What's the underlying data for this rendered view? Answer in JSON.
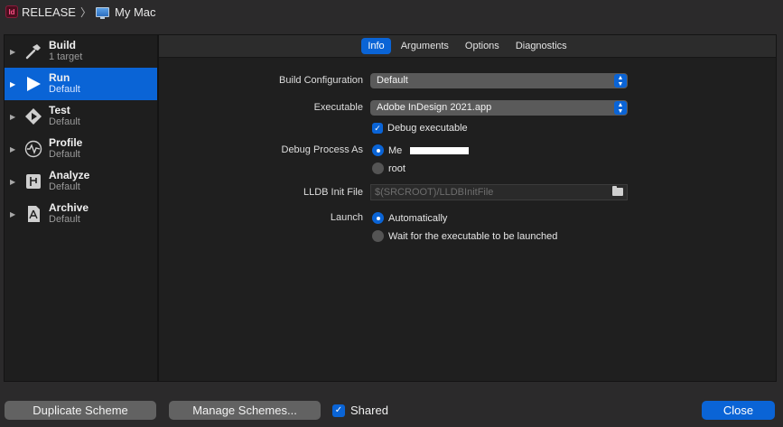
{
  "breadcrumb": {
    "app_badge": "Id",
    "scheme": "RELEASE",
    "separator": "〉",
    "destination": "My Mac"
  },
  "sidebar": {
    "items": [
      {
        "title": "Build",
        "subtitle": "1 target",
        "icon": "hammer-icon",
        "selected": false
      },
      {
        "title": "Run",
        "subtitle": "Default",
        "icon": "play-icon",
        "selected": true
      },
      {
        "title": "Test",
        "subtitle": "Default",
        "icon": "test-diamond-icon",
        "selected": false
      },
      {
        "title": "Profile",
        "subtitle": "Default",
        "icon": "waveform-icon",
        "selected": false
      },
      {
        "title": "Analyze",
        "subtitle": "Default",
        "icon": "analyze-icon",
        "selected": false
      },
      {
        "title": "Archive",
        "subtitle": "Default",
        "icon": "archive-icon",
        "selected": false
      }
    ]
  },
  "tabs": [
    {
      "label": "Info",
      "active": true
    },
    {
      "label": "Arguments",
      "active": false
    },
    {
      "label": "Options",
      "active": false
    },
    {
      "label": "Diagnostics",
      "active": false
    }
  ],
  "info": {
    "build_configuration_label": "Build Configuration",
    "build_configuration_value": "Default",
    "executable_label": "Executable",
    "executable_value": "Adobe InDesign 2021.app",
    "debug_executable_label": "Debug executable",
    "debug_executable_checked": true,
    "debug_process_label": "Debug Process As",
    "debug_process_me": "Me",
    "debug_process_root": "root",
    "lldb_label": "LLDB Init File",
    "lldb_placeholder": "$(SRCROOT)/LLDBInitFile",
    "launch_label": "Launch",
    "launch_auto": "Automatically",
    "launch_wait": "Wait for the executable to be launched"
  },
  "footer": {
    "duplicate_label": "Duplicate Scheme",
    "manage_label": "Manage Schemes...",
    "shared_label": "Shared",
    "shared_checked": true,
    "close_label": "Close"
  },
  "colors": {
    "accent": "#0a64d6",
    "window_bg": "#2b2a2b",
    "panel_bg": "#1f1f1f"
  }
}
